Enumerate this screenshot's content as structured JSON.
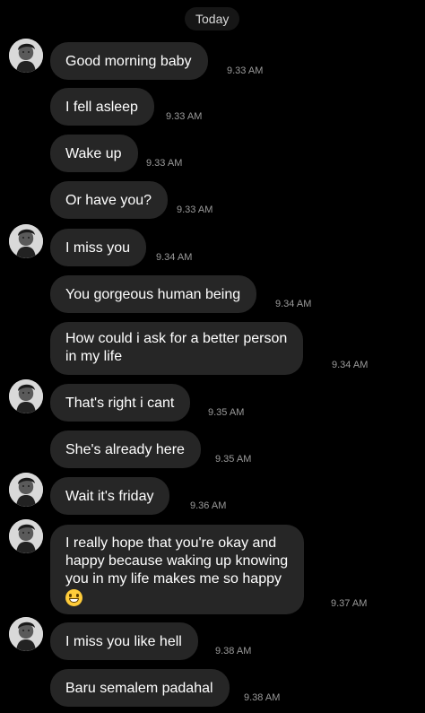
{
  "chat": {
    "date_label": "Today",
    "messages": [
      {
        "text": "Good morning baby",
        "time": "9.33 AM"
      },
      {
        "text": "I fell asleep",
        "time": "9.33 AM"
      },
      {
        "text": "Wake up",
        "time": "9.33 AM"
      },
      {
        "text": "Or have you?",
        "time": "9.33 AM"
      },
      {
        "text": "I miss you",
        "time": "9.34 AM"
      },
      {
        "text": "You gorgeous human being",
        "time": "9.34 AM"
      },
      {
        "lines": [
          "How could i ask for a better person",
          "in my life"
        ],
        "time": "9.34 AM"
      },
      {
        "text": "That's right i cant",
        "time": "9.35 AM"
      },
      {
        "text": "She's already here",
        "time": "9.35 AM"
      },
      {
        "text": "Wait it's friday",
        "time": "9.36 AM"
      },
      {
        "lines": [
          "I really hope that you're okay and",
          "happy because waking up knowing",
          "you in my life makes me so happy"
        ],
        "emoji": "grinning-face-icon",
        "time": "9.37 AM"
      },
      {
        "text": "I miss you like hell",
        "time": "9.38 AM"
      },
      {
        "text": "Baru semalem padahal",
        "time": "9.38 AM"
      }
    ]
  },
  "colors": {
    "background": "#000000",
    "bubble": "#262626",
    "timestamp": "#9a9a9a",
    "text": "#ffffff"
  }
}
